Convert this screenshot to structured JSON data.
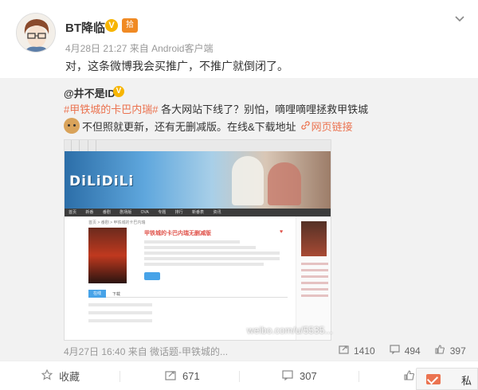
{
  "post": {
    "author": "BT降临",
    "verified_mark": "V",
    "level_badge": "拾",
    "timestamp": "4月28日 21:27",
    "source_prefix": "来自",
    "source": "Android客户端",
    "text": "对，这条微博我会买推广，不推广就倒闭了。"
  },
  "repost": {
    "author": "@井不是ID",
    "verified_mark": "V",
    "hashtag": "#甲铁城的卡巴内瑞#",
    "line1_rest": " 各大网站下线了？别怕，嘀哩嘀哩拯救甲铁城",
    "line2": "不但照就更新，还有无删减版。在线&下载地址",
    "link_icon": "link-icon",
    "link_text": "网页链接",
    "meta": "4月27日 16:40 来自 微话题-甲铁城的...",
    "stats": {
      "reposts": "1410",
      "comments": "494",
      "likes": "397"
    }
  },
  "screenshot": {
    "site_logo": "DiLiDiLi",
    "anime_title": "甲铁城的卡巴内瑞无删减版",
    "heart": "♥",
    "tab_active": "在线",
    "tab_other": "下载",
    "crumb": "首页 > 番剧 > 甲铁城的卡巴内瑞",
    "nav_items": [
      "首页",
      "新番",
      "番剧",
      "剧场版",
      "OVA",
      "专题",
      "排行",
      "新番表",
      "资讯"
    ],
    "watermark": "weibo.com/u/5535..."
  },
  "actions": {
    "favorite": "收藏",
    "repost_count": "671",
    "comment_count": "307",
    "message_label": "私信"
  },
  "colors": {
    "accent": "#eb7350",
    "verified": "#f7b500"
  }
}
